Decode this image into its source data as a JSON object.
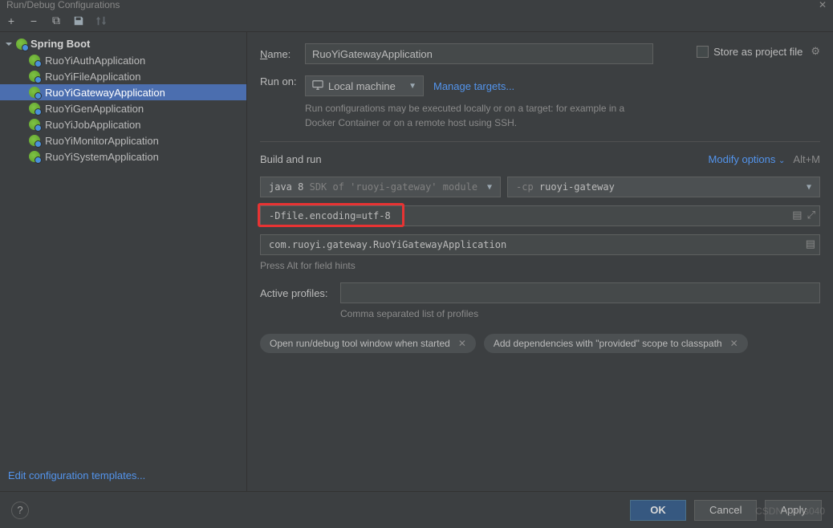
{
  "titlebar": {
    "title": "Run/Debug Configurations"
  },
  "toolbar": {
    "add": "+",
    "remove": "−",
    "copy": "⧉",
    "save": "💾",
    "sort": "↕"
  },
  "sidebar": {
    "root": "Spring Boot",
    "items": [
      "RuoYiAuthApplication",
      "RuoYiFileApplication",
      "RuoYiGatewayApplication",
      "RuoYiGenApplication",
      "RuoYiJobApplication",
      "RuoYiMonitorApplication",
      "RuoYiSystemApplication"
    ],
    "selected": 2,
    "edit_templates": "Edit configuration templates..."
  },
  "form": {
    "name_label_pre": "N",
    "name_label_post": "ame:",
    "name_value": "RuoYiGatewayApplication",
    "store_label_pre": "S",
    "store_label_post": "tore as project file",
    "runon_label": "Run on:",
    "runon_value": "Local machine",
    "manage_targets": "Manage targets...",
    "runon_hint": "Run configurations may be executed locally or on a target: for example in a Docker Container or on a remote host using SSH.",
    "build_run_title": "Build and run",
    "modify_label_pre": "M",
    "modify_label_post": "odify options",
    "altm": "Alt+M",
    "sdk_value": "java 8",
    "sdk_hint": "SDK of 'ruoyi-gateway' module",
    "cp_prefix": "-cp",
    "cp_value": "ruoyi-gateway",
    "vm_options": "-Dfile.encoding=utf-8",
    "main_class": "com.ruoyi.gateway.RuoYiGatewayApplication",
    "alt_hint": "Press Alt for field hints",
    "active_profiles_label": "Active profiles:",
    "active_profiles_value": "",
    "comma_hint": "Comma separated list of profiles",
    "chip1": "Open run/debug tool window when started",
    "chip2": "Add dependencies with \"provided\" scope to classpath"
  },
  "footer": {
    "ok": "OK",
    "cancel": "Cancel",
    "apply": "Apply"
  },
  "watermark": "CSDN @wjs040"
}
